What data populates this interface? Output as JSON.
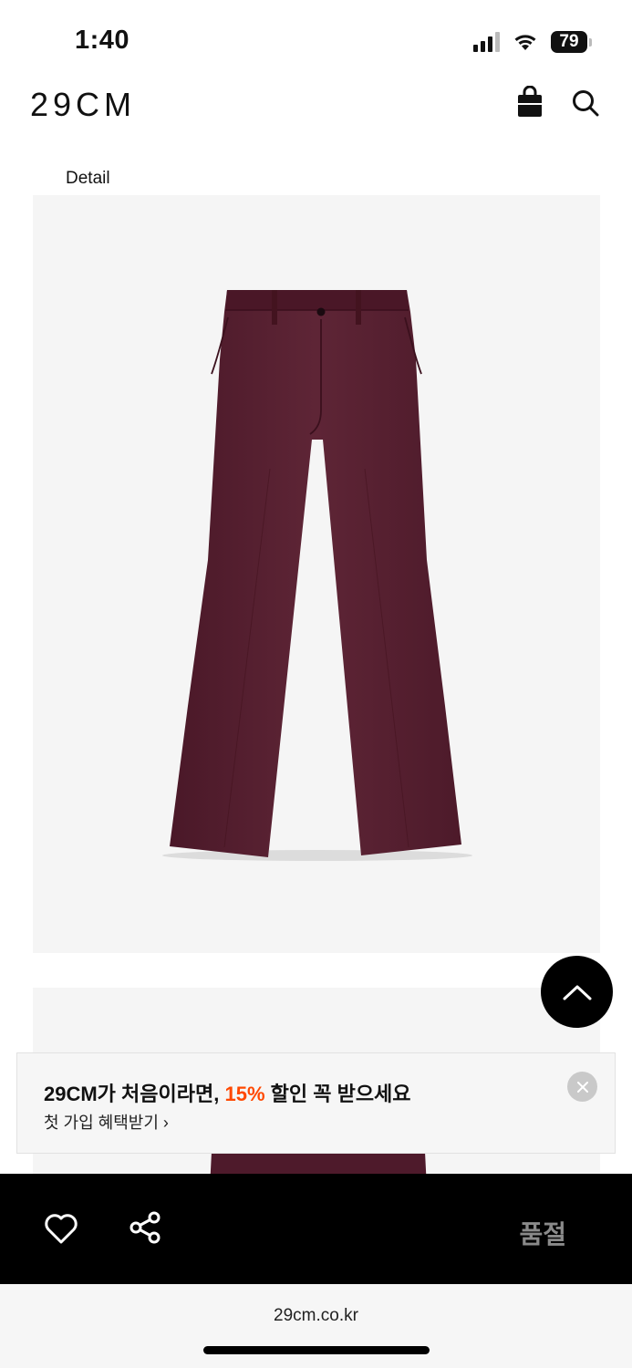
{
  "status_bar": {
    "time": "1:40",
    "battery": "79"
  },
  "header": {
    "logo": "29CM"
  },
  "detail_label": "Detail",
  "promo": {
    "title_prefix": "29CM가 처음이라면, ",
    "title_highlight": "15%",
    "title_suffix": " 할인 꼭 받으세요",
    "subtitle": "첫 가입 혜택받기 ›",
    "highlight_color": "#ff4800"
  },
  "bottom_bar": {
    "status_label": "품절"
  },
  "browser": {
    "url": "29cm.co.kr"
  },
  "icons": [
    "bag-icon",
    "search-icon",
    "chevron-up-icon",
    "close-icon",
    "heart-icon",
    "share-icon"
  ]
}
